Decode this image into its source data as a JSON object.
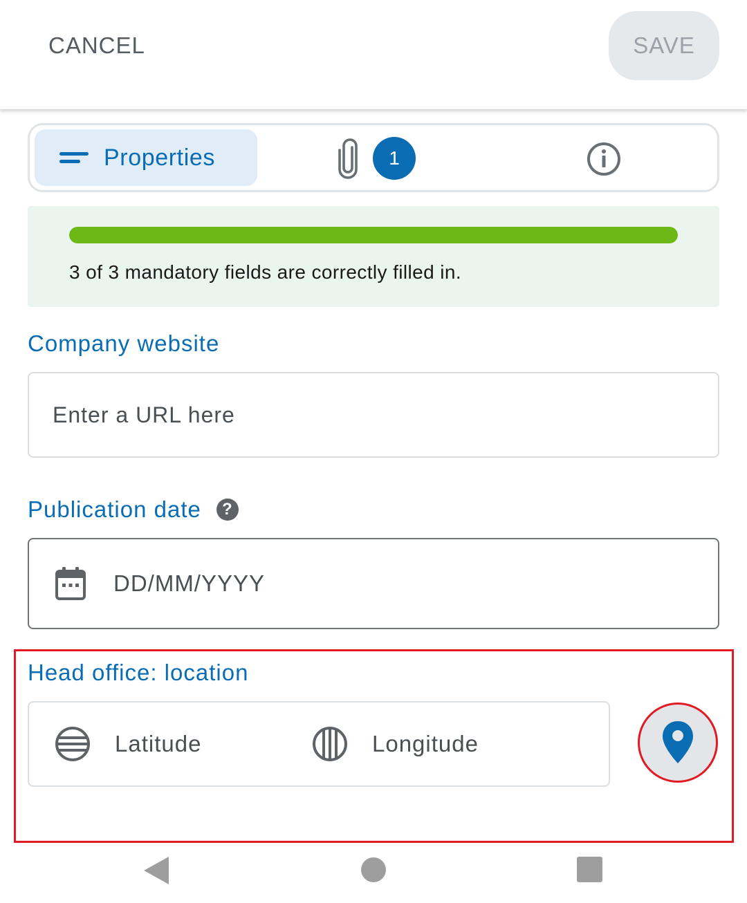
{
  "header": {
    "cancel_label": "CANCEL",
    "save_label": "SAVE"
  },
  "tabs": {
    "properties_label": "Properties",
    "attachments_count": "1"
  },
  "progress": {
    "fraction": 1.0,
    "status_text": "3 of 3 mandatory fields are correctly filled in."
  },
  "fields": {
    "website": {
      "label": "Company website",
      "placeholder": "Enter a URL here"
    },
    "publication_date": {
      "label": "Publication date",
      "help": "?",
      "placeholder": "DD/MM/YYYY"
    },
    "location": {
      "label": "Head office: location",
      "latitude_placeholder": "Latitude",
      "longitude_placeholder": "Longitude"
    }
  },
  "colors": {
    "accent": "#0a6db4",
    "progress": "#6cb915",
    "highlight": "#e01b24"
  },
  "icons": {
    "properties": "lines-icon",
    "attachments": "paperclip-icon",
    "info": "info-icon",
    "date": "calendar-icon",
    "latitude": "latitude-icon",
    "longitude": "longitude-icon",
    "location_button": "map-pin-icon"
  }
}
